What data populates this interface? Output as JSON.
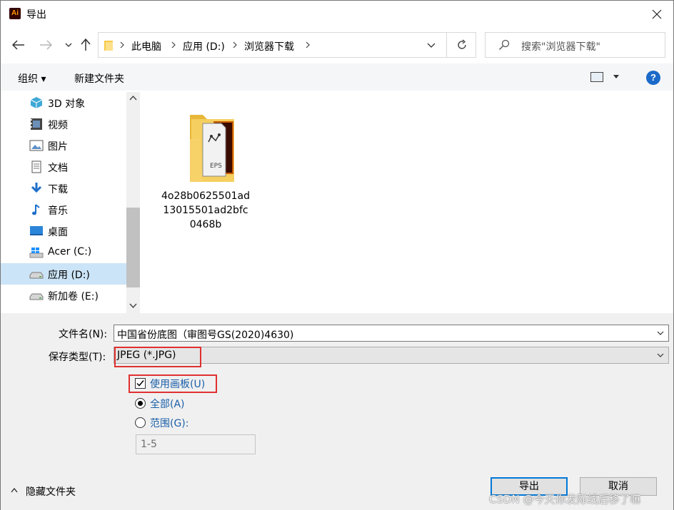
{
  "window": {
    "app_icon_text": "Ai",
    "title": "导出",
    "close_icon": "close-icon"
  },
  "nav": {
    "back_icon": "arrow-left-icon",
    "forward_icon": "arrow-right-icon",
    "recent_icon": "chevron-down-icon",
    "up_icon": "arrow-up-icon",
    "breadcrumbs": [
      "此电脑",
      "应用 (D:)",
      "浏览器下载"
    ],
    "refresh_icon": "refresh-icon",
    "search_placeholder": "搜索\"浏览器下载\""
  },
  "toolbar": {
    "organize": "组织 ▾",
    "new_folder": "新建文件夹",
    "help": "?"
  },
  "sidebar": {
    "items": [
      {
        "label": "3D 对象",
        "icon": "cube-icon"
      },
      {
        "label": "视频",
        "icon": "video-icon"
      },
      {
        "label": "图片",
        "icon": "picture-icon"
      },
      {
        "label": "文档",
        "icon": "document-icon"
      },
      {
        "label": "下载",
        "icon": "download-icon"
      },
      {
        "label": "音乐",
        "icon": "music-icon"
      },
      {
        "label": "桌面",
        "icon": "desktop-icon"
      },
      {
        "label": "Acer (C:)",
        "icon": "drive-icon"
      },
      {
        "label": "应用 (D:)",
        "icon": "drive-icon",
        "selected": true
      },
      {
        "label": "新加卷 (E:)",
        "icon": "drive-icon"
      }
    ]
  },
  "files": [
    {
      "name": "4o28b0625501ad13015501ad2bfc0468b",
      "icon": "eps-folder-icon",
      "icon_text": "EPS"
    }
  ],
  "form": {
    "filename_label": "文件名(N):",
    "filename_value": "中国省份底图（审图号GS(2020)4630)",
    "filetype_label": "保存类型(T):",
    "filetype_value": "JPEG (*.JPG)",
    "use_artboards": "使用画板(U)",
    "use_artboards_checked": true,
    "all_label": "全部(A)",
    "range_label": "范围(G):",
    "range_value": "1-5",
    "selected_option": "all"
  },
  "footer": {
    "hide_folders": "隐藏文件夹",
    "export_button": "导出",
    "cancel_button": "取消",
    "watermark": "CSDN @今天你发际线后移了嘛"
  },
  "colors": {
    "highlight_box": "#e03030",
    "selection": "#cce4f7",
    "link_blue": "#1a5fa8",
    "primary_border": "#0078d7"
  }
}
